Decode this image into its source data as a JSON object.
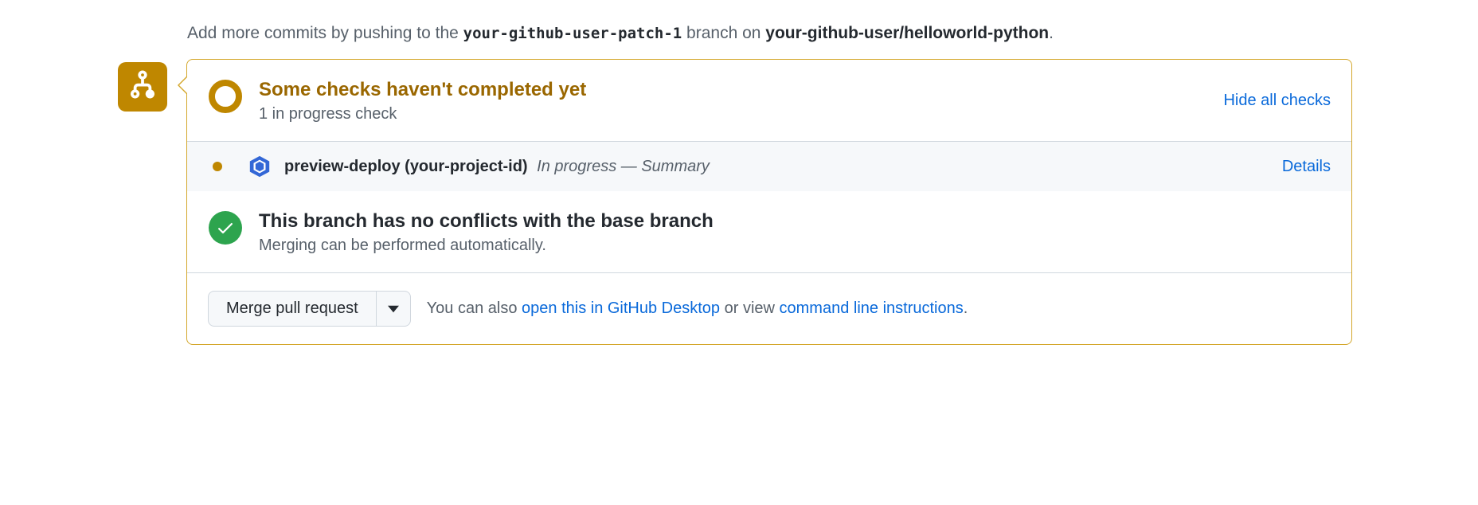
{
  "push_hint": {
    "prefix": "Add more commits by pushing to the ",
    "branch": "your-github-user-patch-1",
    "middle": " branch on ",
    "repo": "your-github-user/helloworld-python",
    "suffix": "."
  },
  "checks": {
    "title": "Some checks haven't completed yet",
    "subtitle": "1 in progress check",
    "toggle_label": "Hide all checks",
    "items": [
      {
        "name": "preview-deploy (your-project-id)",
        "status_text": "In progress — Summary",
        "details_label": "Details"
      }
    ]
  },
  "merge_status": {
    "title": "This branch has no conflicts with the base branch",
    "subtitle": "Merging can be performed automatically."
  },
  "footer": {
    "merge_button": "Merge pull request",
    "also_prefix": "You can also ",
    "desktop_link": "open this in GitHub Desktop",
    "also_middle": " or view ",
    "cli_link": "command line instructions",
    "also_suffix": "."
  }
}
